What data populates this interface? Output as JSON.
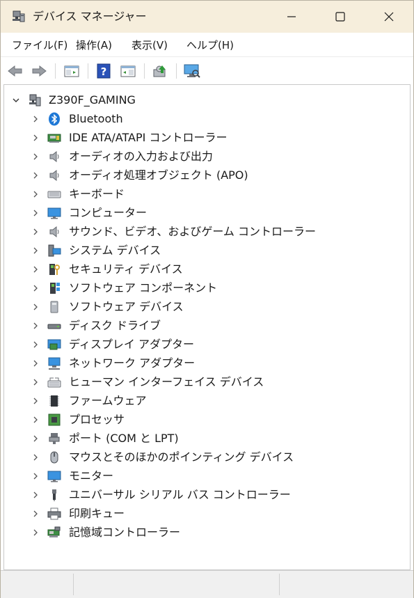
{
  "window": {
    "title": "デバイス マネージャー",
    "controls": {
      "minimize": "minimize-icon",
      "maximize": "maximize-icon",
      "close": "close-icon"
    }
  },
  "menu": [
    "ファイル(F)",
    "操作(A)",
    "表示(V)",
    "ヘルプ(H)"
  ],
  "toolbar": {
    "buttons": [
      "back-arrow-icon",
      "forward-arrow-icon",
      "properties-pane-icon",
      "help-icon",
      "show-hide-pane-icon",
      "update-driver-icon",
      "scan-hardware-icon"
    ]
  },
  "tree": {
    "root": {
      "label": "Z390F_GAMING",
      "icon": "computer-tower-icon",
      "expanded": true
    },
    "items": [
      {
        "label": "Bluetooth",
        "icon": "bluetooth-icon"
      },
      {
        "label": "IDE ATA/ATAPI コントローラー",
        "icon": "ide-controller-icon"
      },
      {
        "label": "オーディオの入力および出力",
        "icon": "speaker-icon"
      },
      {
        "label": "オーディオ処理オブジェクト (APO)",
        "icon": "speaker-icon"
      },
      {
        "label": "キーボード",
        "icon": "keyboard-icon"
      },
      {
        "label": "コンピューター",
        "icon": "monitor-icon"
      },
      {
        "label": "サウンド、ビデオ、およびゲーム コントローラー",
        "icon": "speaker-icon"
      },
      {
        "label": "システム デバイス",
        "icon": "system-device-icon"
      },
      {
        "label": "セキュリティ デバイス",
        "icon": "security-key-icon"
      },
      {
        "label": "ソフトウェア コンポーネント",
        "icon": "software-component-icon"
      },
      {
        "label": "ソフトウェア デバイス",
        "icon": "software-device-icon"
      },
      {
        "label": "ディスク ドライブ",
        "icon": "disk-drive-icon"
      },
      {
        "label": "ディスプレイ アダプター",
        "icon": "display-adapter-icon"
      },
      {
        "label": "ネットワーク アダプター",
        "icon": "network-adapter-icon"
      },
      {
        "label": "ヒューマン インターフェイス デバイス",
        "icon": "hid-icon"
      },
      {
        "label": "ファームウェア",
        "icon": "firmware-chip-icon"
      },
      {
        "label": "プロセッサ",
        "icon": "processor-icon"
      },
      {
        "label": "ポート (COM と LPT)",
        "icon": "port-icon"
      },
      {
        "label": "マウスとそのほかのポインティング デバイス",
        "icon": "mouse-icon"
      },
      {
        "label": "モニター",
        "icon": "monitor-icon"
      },
      {
        "label": "ユニバーサル シリアル バス コントローラー",
        "icon": "usb-icon"
      },
      {
        "label": "印刷キュー",
        "icon": "printer-icon"
      },
      {
        "label": "記憶域コントローラー",
        "icon": "storage-controller-icon"
      }
    ]
  },
  "colors": {
    "titlebar": "#f6eedc",
    "accent": "#1e78d6"
  }
}
